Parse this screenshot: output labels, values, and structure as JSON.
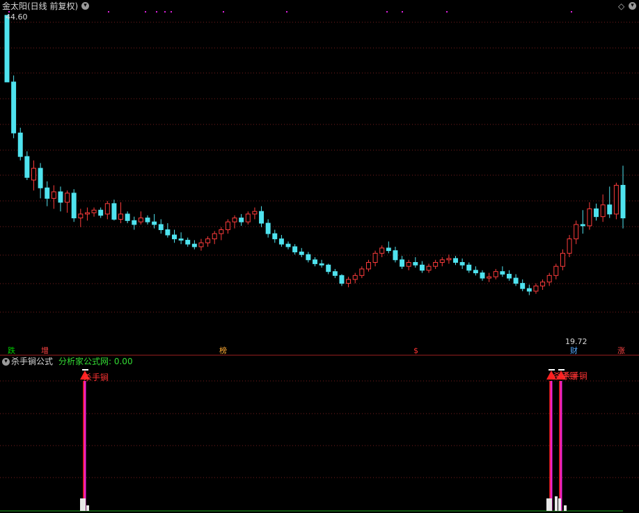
{
  "window": {
    "title": "金太阳(日线 前复权)",
    "diamond_icon": "diamond-icon",
    "dropdown_icon": "chevron-down-icon"
  },
  "main_panel": {
    "high_label": "44.60",
    "low_label": "19.72",
    "events": [
      {
        "text": "跌",
        "color": "#00cc00",
        "bg": "#0a2a0a"
      },
      {
        "text": "增",
        "color": "#ff4444",
        "bg": "#2a0a0a"
      },
      {
        "text": "榜",
        "color": "#ffaa33",
        "bg": "#2a1a00"
      },
      {
        "text": "$",
        "color": "#ff3333",
        "bg": "transparent"
      },
      {
        "text": "财",
        "color": "#55aaff",
        "bg": "#0a1a3a"
      },
      {
        "text": "涨",
        "color": "#ff4444",
        "bg": "#2a0a0a"
      }
    ]
  },
  "indicator_panel": {
    "name": "杀手锏公式",
    "source_label": "分析家公式网: 0.00",
    "signal_labels": [
      "杀手锏",
      "杀手锏",
      "杀手锏"
    ]
  },
  "colors": {
    "up": "#ff3c3c",
    "down": "#4fe3ef",
    "grid": "#7a1e1e",
    "signal_line": "#ee22cc",
    "signal_arrow": "#ff2020",
    "title": "#d8d8d8",
    "green_text": "#33dd33"
  },
  "chart_data": {
    "type": "candlestick",
    "ohlc": [
      [
        44.6,
        44.6,
        39.5,
        39.5
      ],
      [
        39.5,
        40.0,
        35.2,
        35.6
      ],
      [
        35.6,
        36.0,
        33.5,
        33.8
      ],
      [
        33.8,
        34.2,
        32.0,
        32.2
      ],
      [
        32.0,
        33.5,
        31.2,
        32.9
      ],
      [
        32.9,
        33.3,
        30.6,
        31.4
      ],
      [
        31.4,
        31.9,
        30.0,
        30.6
      ],
      [
        30.6,
        31.6,
        29.8,
        31.1
      ],
      [
        31.1,
        31.5,
        29.6,
        30.3
      ],
      [
        30.3,
        31.2,
        29.5,
        31.0
      ],
      [
        31.0,
        31.3,
        28.8,
        29.1
      ],
      [
        29.1,
        29.8,
        28.4,
        29.4
      ],
      [
        29.4,
        29.9,
        28.9,
        29.5
      ],
      [
        29.5,
        29.9,
        29.2,
        29.7
      ],
      [
        29.7,
        29.9,
        29.1,
        29.3
      ],
      [
        29.4,
        30.4,
        29.0,
        30.2
      ],
      [
        30.2,
        30.5,
        28.9,
        29.0
      ],
      [
        29.0,
        30.3,
        28.7,
        29.4
      ],
      [
        29.4,
        29.6,
        28.7,
        28.9
      ],
      [
        28.9,
        29.2,
        28.2,
        28.6
      ],
      [
        28.8,
        29.6,
        28.6,
        29.1
      ],
      [
        29.1,
        29.3,
        28.6,
        28.8
      ],
      [
        28.8,
        29.4,
        28.3,
        28.6
      ],
      [
        28.6,
        29.0,
        27.9,
        28.2
      ],
      [
        28.2,
        28.7,
        27.6,
        27.8
      ],
      [
        27.8,
        28.2,
        27.2,
        27.5
      ],
      [
        27.5,
        28.0,
        27.1,
        27.4
      ],
      [
        27.4,
        27.6,
        26.9,
        27.1
      ],
      [
        27.1,
        27.4,
        26.7,
        26.9
      ],
      [
        26.9,
        27.5,
        26.6,
        27.2
      ],
      [
        27.2,
        27.7,
        26.9,
        27.5
      ],
      [
        27.5,
        28.1,
        27.1,
        27.9
      ],
      [
        27.9,
        28.4,
        27.4,
        28.2
      ],
      [
        28.2,
        29.0,
        27.9,
        28.8
      ],
      [
        28.8,
        29.3,
        28.3,
        29.1
      ],
      [
        29.1,
        29.4,
        28.5,
        28.8
      ],
      [
        28.8,
        29.6,
        28.6,
        29.4
      ],
      [
        29.4,
        29.9,
        29.0,
        29.6
      ],
      [
        29.6,
        30.0,
        28.4,
        28.7
      ],
      [
        28.7,
        29.0,
        27.6,
        27.9
      ],
      [
        27.9,
        28.2,
        27.2,
        27.5
      ],
      [
        27.5,
        27.8,
        26.9,
        27.1
      ],
      [
        27.1,
        27.3,
        26.7,
        26.9
      ],
      [
        26.9,
        27.1,
        26.3,
        26.5
      ],
      [
        26.5,
        26.8,
        26.1,
        26.3
      ],
      [
        26.3,
        26.5,
        25.7,
        25.9
      ],
      [
        25.9,
        26.1,
        25.4,
        25.6
      ],
      [
        25.6,
        25.9,
        25.3,
        25.5
      ],
      [
        25.5,
        25.6,
        24.8,
        25.0
      ],
      [
        25.0,
        25.2,
        24.5,
        24.7
      ],
      [
        24.7,
        24.8,
        23.9,
        24.1
      ],
      [
        24.1,
        24.6,
        23.8,
        24.4
      ],
      [
        24.4,
        24.9,
        24.1,
        24.7
      ],
      [
        24.7,
        25.4,
        24.5,
        25.2
      ],
      [
        25.2,
        25.9,
        25.0,
        25.7
      ],
      [
        25.7,
        26.6,
        25.4,
        26.4
      ],
      [
        26.4,
        27.0,
        26.1,
        26.8
      ],
      [
        26.8,
        27.3,
        26.4,
        26.6
      ],
      [
        26.6,
        26.9,
        25.7,
        25.9
      ],
      [
        25.9,
        26.2,
        25.2,
        25.4
      ],
      [
        25.4,
        25.9,
        25.1,
        25.7
      ],
      [
        25.7,
        26.1,
        25.3,
        25.5
      ],
      [
        25.5,
        25.8,
        24.9,
        25.1
      ],
      [
        25.1,
        25.6,
        24.9,
        25.4
      ],
      [
        25.4,
        25.9,
        25.2,
        25.7
      ],
      [
        25.7,
        26.1,
        25.4,
        25.9
      ],
      [
        25.9,
        26.3,
        25.6,
        26.0
      ],
      [
        26.0,
        26.2,
        25.5,
        25.7
      ],
      [
        25.7,
        26.0,
        25.2,
        25.5
      ],
      [
        25.5,
        25.7,
        24.9,
        25.1
      ],
      [
        25.1,
        25.4,
        24.7,
        24.9
      ],
      [
        24.9,
        25.1,
        24.3,
        24.5
      ],
      [
        24.5,
        24.9,
        24.2,
        24.6
      ],
      [
        24.6,
        25.2,
        24.4,
        25.0
      ],
      [
        25.0,
        25.4,
        24.6,
        24.8
      ],
      [
        24.8,
        25.1,
        24.3,
        24.5
      ],
      [
        24.5,
        24.8,
        23.9,
        24.1
      ],
      [
        24.1,
        24.4,
        23.5,
        23.7
      ],
      [
        23.7,
        24.0,
        23.2,
        23.5
      ],
      [
        23.5,
        24.1,
        23.3,
        23.9
      ],
      [
        23.9,
        24.4,
        23.6,
        24.2
      ],
      [
        24.2,
        24.9,
        23.9,
        24.7
      ],
      [
        24.7,
        25.6,
        24.4,
        25.4
      ],
      [
        25.4,
        26.7,
        25.1,
        26.4
      ],
      [
        26.4,
        27.8,
        26.1,
        27.5
      ],
      [
        27.5,
        28.9,
        27.1,
        28.6
      ],
      [
        28.6,
        29.7,
        27.9,
        28.5
      ],
      [
        28.5,
        30.3,
        28.2,
        29.8
      ],
      [
        29.8,
        30.2,
        28.9,
        29.2
      ],
      [
        29.2,
        30.9,
        28.8,
        30.1
      ],
      [
        30.1,
        31.5,
        29.1,
        29.4
      ],
      [
        29.4,
        31.8,
        29.0,
        31.6
      ],
      [
        31.6,
        33.1,
        28.3,
        29.1
      ]
    ]
  }
}
